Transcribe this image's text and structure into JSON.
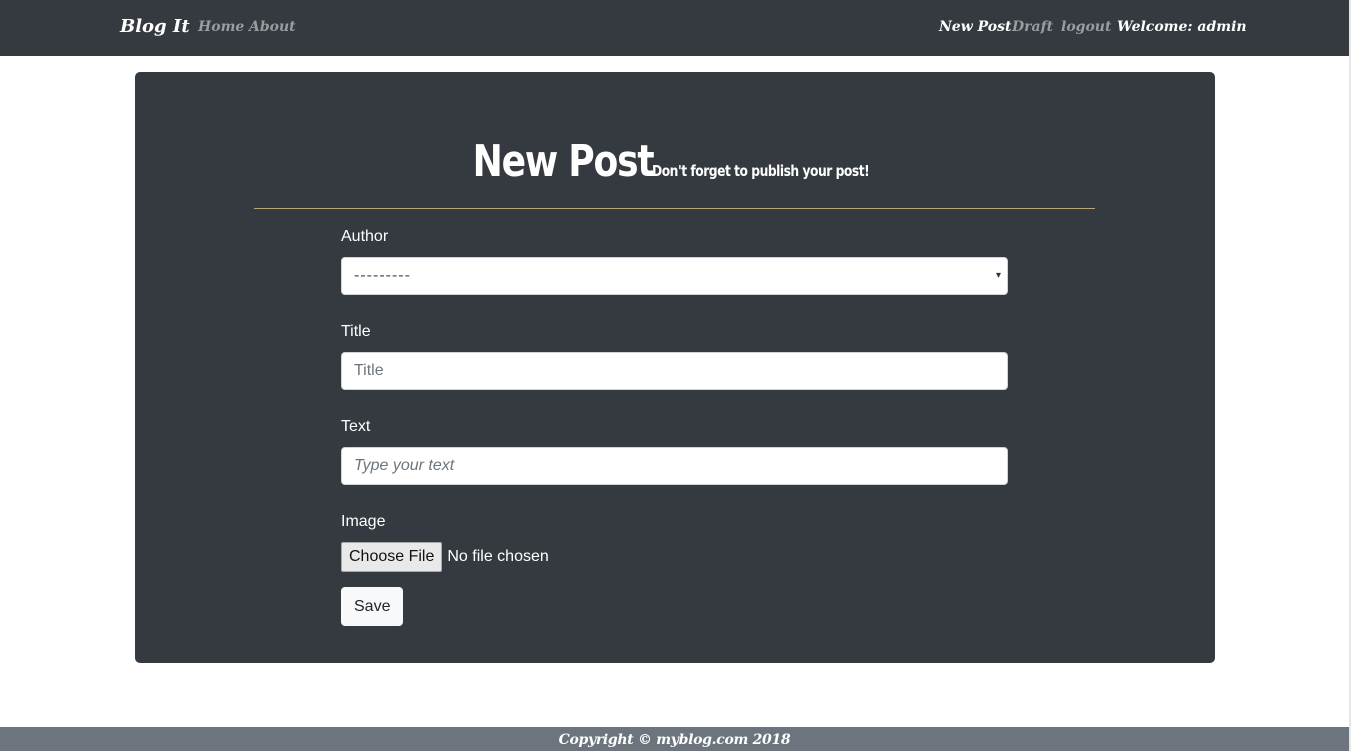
{
  "nav": {
    "brand": "Blog It",
    "left_links": [
      {
        "label": "Home"
      },
      {
        "label": "About"
      }
    ],
    "right_links": [
      {
        "label": "New Post",
        "active": true
      },
      {
        "label": "Draft",
        "active": false
      },
      {
        "label": "logout",
        "active": false
      }
    ],
    "welcome": "Welcome: admin"
  },
  "header": {
    "title": "New Post",
    "subtitle": "Don't forget to publish your post!"
  },
  "form": {
    "author": {
      "label": "Author",
      "selected": "---------"
    },
    "title": {
      "label": "Title",
      "placeholder": "Title"
    },
    "text": {
      "label": "Text",
      "placeholder": "Type your text"
    },
    "image": {
      "label": "Image",
      "button": "Choose File",
      "status": "No file chosen"
    },
    "save_label": "Save"
  },
  "footer": {
    "copyright": "Copyright © myblog.com 2018"
  },
  "colors": {
    "navbar_bg": "#343a40",
    "card_bg": "#343a40",
    "footer_bg": "#6c757d",
    "header_rule": "#c8a93d",
    "nav_muted": "#9a9c9f"
  }
}
